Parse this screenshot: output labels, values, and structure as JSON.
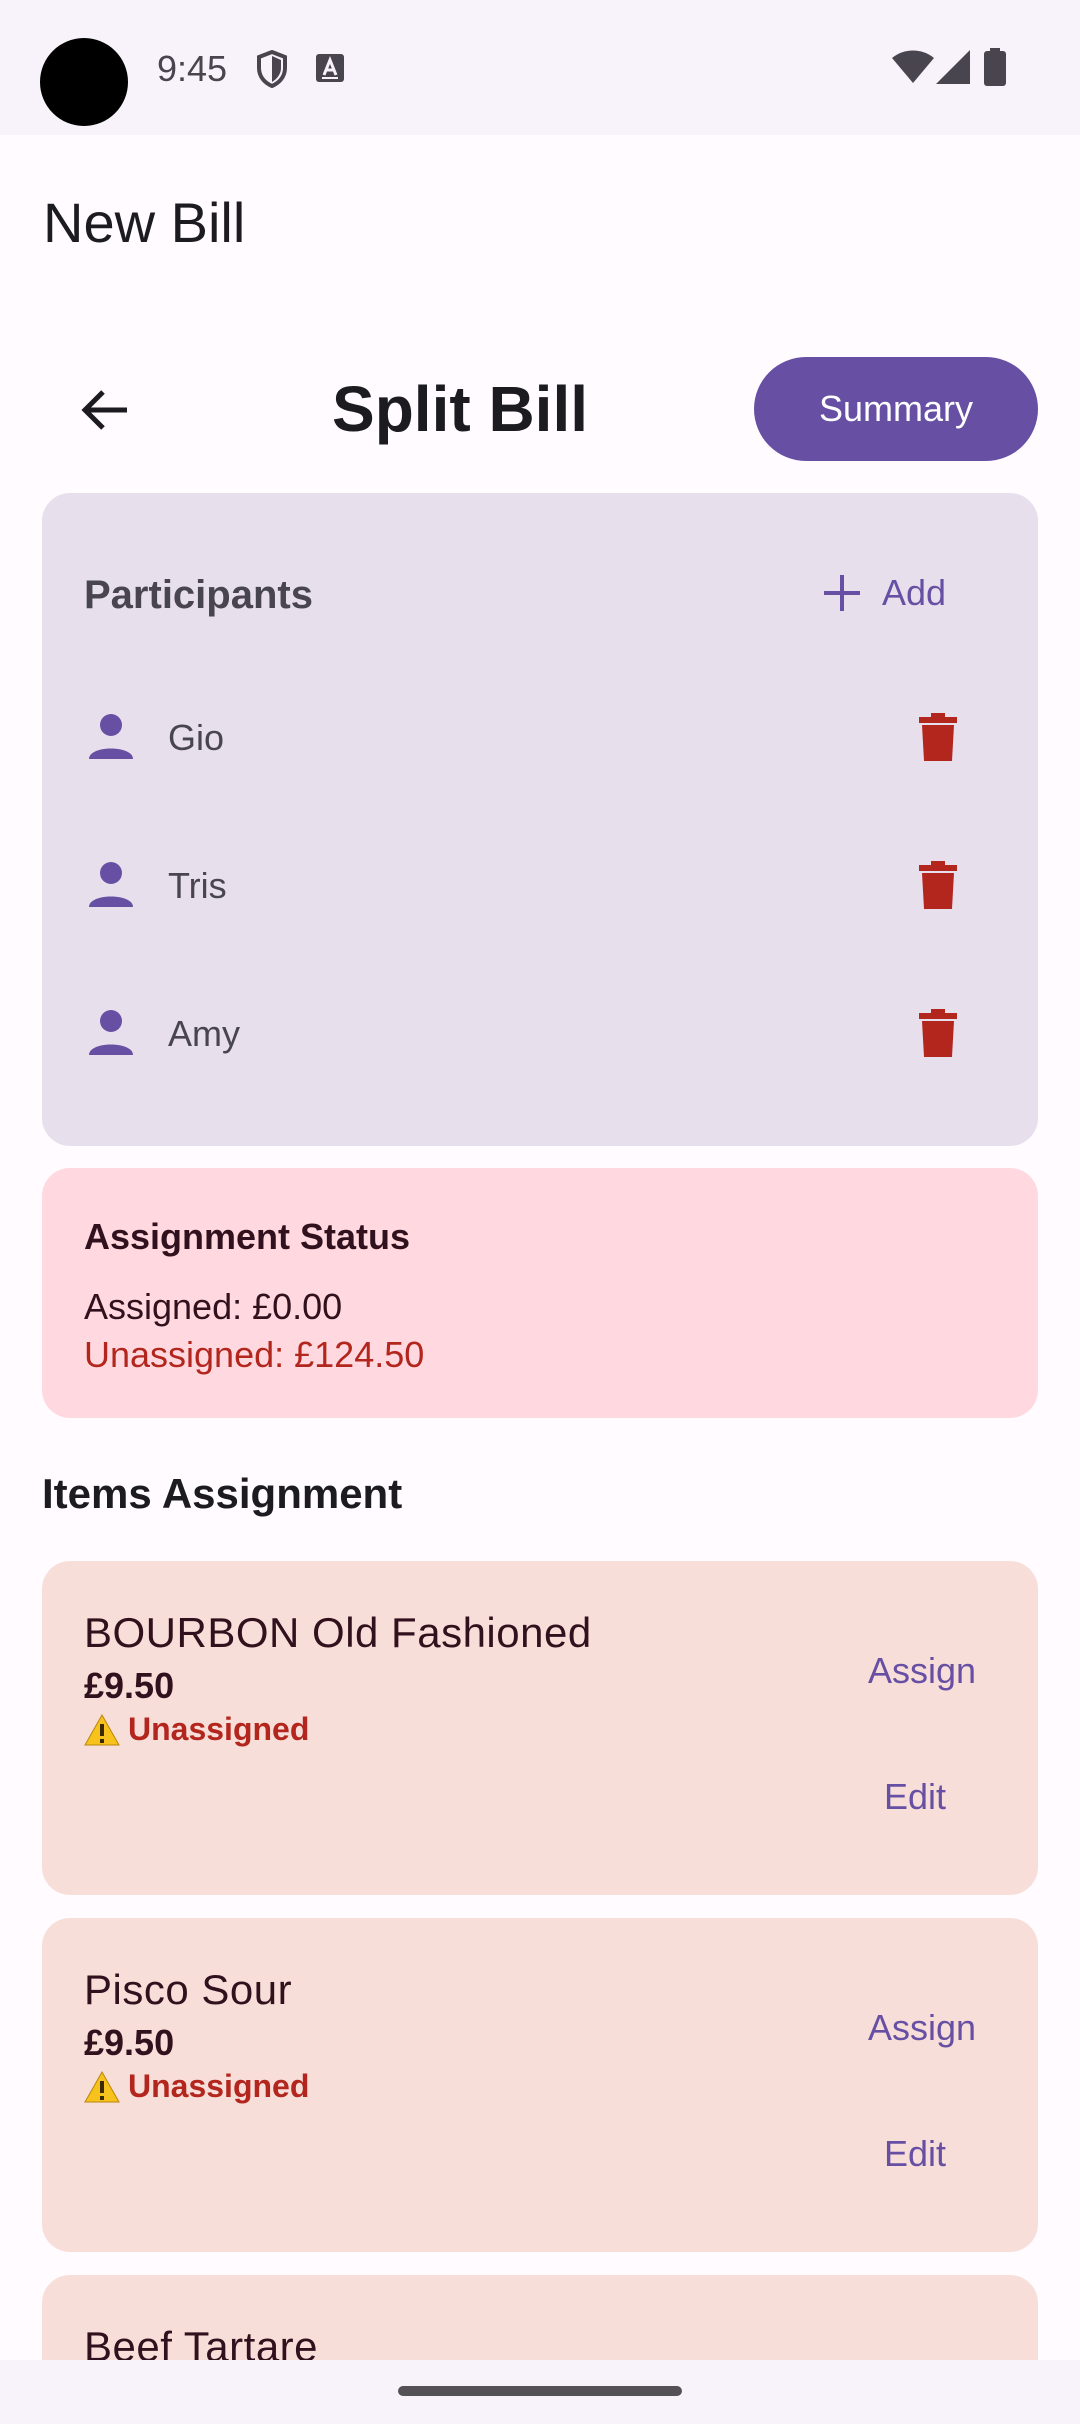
{
  "status_bar": {
    "time": "9:45",
    "icons": [
      "shield-icon",
      "keyboard-a-icon",
      "wifi-icon",
      "signal-icon",
      "battery-icon"
    ]
  },
  "app": {
    "title": "New Bill"
  },
  "header": {
    "title": "Split Bill",
    "summary_label": "Summary",
    "back_icon": "arrow-back-icon"
  },
  "participants": {
    "title": "Participants",
    "add_label": "Add",
    "items": [
      {
        "name": "Gio"
      },
      {
        "name": "Tris"
      },
      {
        "name": "Amy"
      }
    ]
  },
  "assignment_status": {
    "title": "Assignment Status",
    "assigned": "Assigned: £0.00",
    "unassigned": "Unassigned: £124.50"
  },
  "items_section": {
    "title": "Items Assignment",
    "items": [
      {
        "name": "BOURBON Old Fashioned",
        "price": "£9.50",
        "status": "Unassigned",
        "assign_label": "Assign",
        "edit_label": "Edit"
      },
      {
        "name": "Pisco Sour",
        "price": "£9.50",
        "status": "Unassigned",
        "assign_label": "Assign",
        "edit_label": "Edit"
      },
      {
        "name": "Beef Tartare"
      }
    ]
  },
  "colors": {
    "primary": "#6750A4",
    "error": "#B3261E",
    "participants_card": "#E7E0EC",
    "status_card": "#FFD9DF",
    "item_card": "#F8DED9"
  }
}
